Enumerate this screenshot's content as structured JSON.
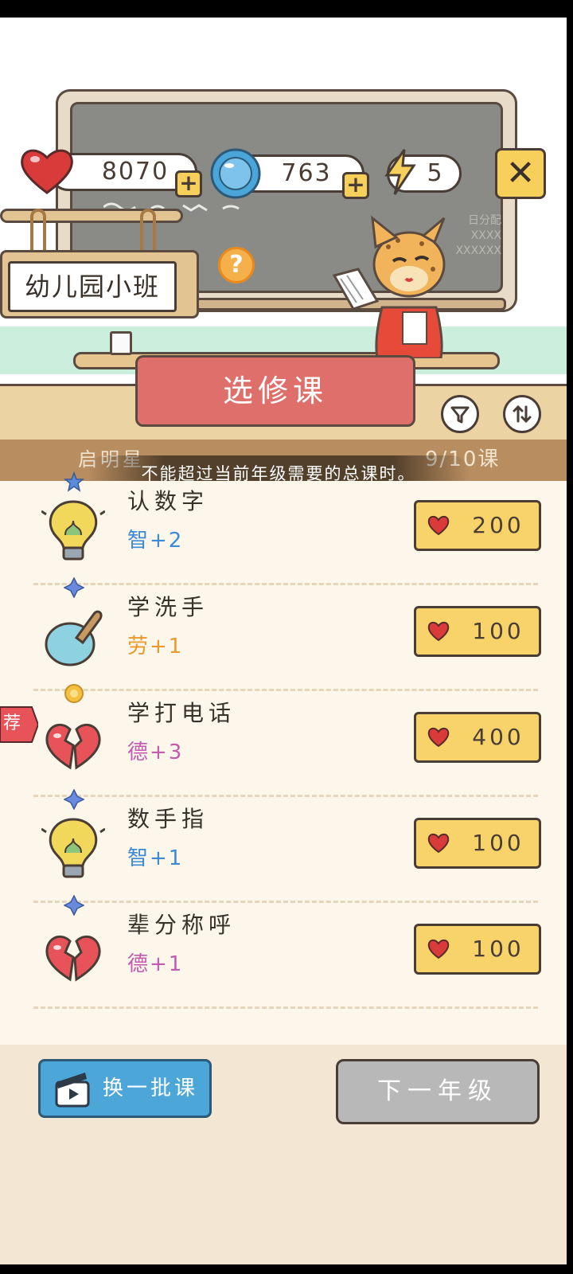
{
  "resources": {
    "hearts": "8070",
    "gems": "763",
    "energy": "5",
    "plus_label": "+",
    "close_label": "✕"
  },
  "board": {
    "note_line1": "日分配",
    "note_line2": "XXXX",
    "note_line3": "XXXXXX"
  },
  "grade_sign": "幼儿园小班",
  "help_label": "?",
  "panel_title": "选修课",
  "status": {
    "school_fragment": "启明星",
    "progress": "9/10课"
  },
  "toast": "不能超过当前年级需要的总课时。",
  "recommend_tag": "荐",
  "courses": [
    {
      "name": "认数字",
      "stat": "智+2",
      "stat_color": "#3c8ad6",
      "price": "200",
      "icon": "lightbulb-icon",
      "star": "blue-star-icon"
    },
    {
      "name": "学洗手",
      "stat": "劳+1",
      "stat_color": "#e89a2c",
      "price": "100",
      "icon": "soap-brush-icon",
      "star": "blue-diamond-star-icon"
    },
    {
      "name": "学打电话",
      "stat": "德+3",
      "stat_color": "#c25ab0",
      "price": "400",
      "icon": "broken-heart-icon",
      "star": "gold-flower-icon"
    },
    {
      "name": "数手指",
      "stat": "智+1",
      "stat_color": "#3c8ad6",
      "price": "100",
      "icon": "lightbulb-icon",
      "star": "blue-diamond-star-icon"
    },
    {
      "name": "辈分称呼",
      "stat": "德+1",
      "stat_color": "#c25ab0",
      "price": "100",
      "icon": "broken-heart-icon",
      "star": "blue-diamond-star-icon"
    }
  ],
  "buttons": {
    "shuffle": "换一批课",
    "next_grade": "下一年级"
  },
  "colors": {
    "accent_red": "#df6f6a",
    "price_yellow": "#f7d36a",
    "shuffle_blue": "#4ca6d8",
    "disabled_gray": "#b8b8b8"
  }
}
